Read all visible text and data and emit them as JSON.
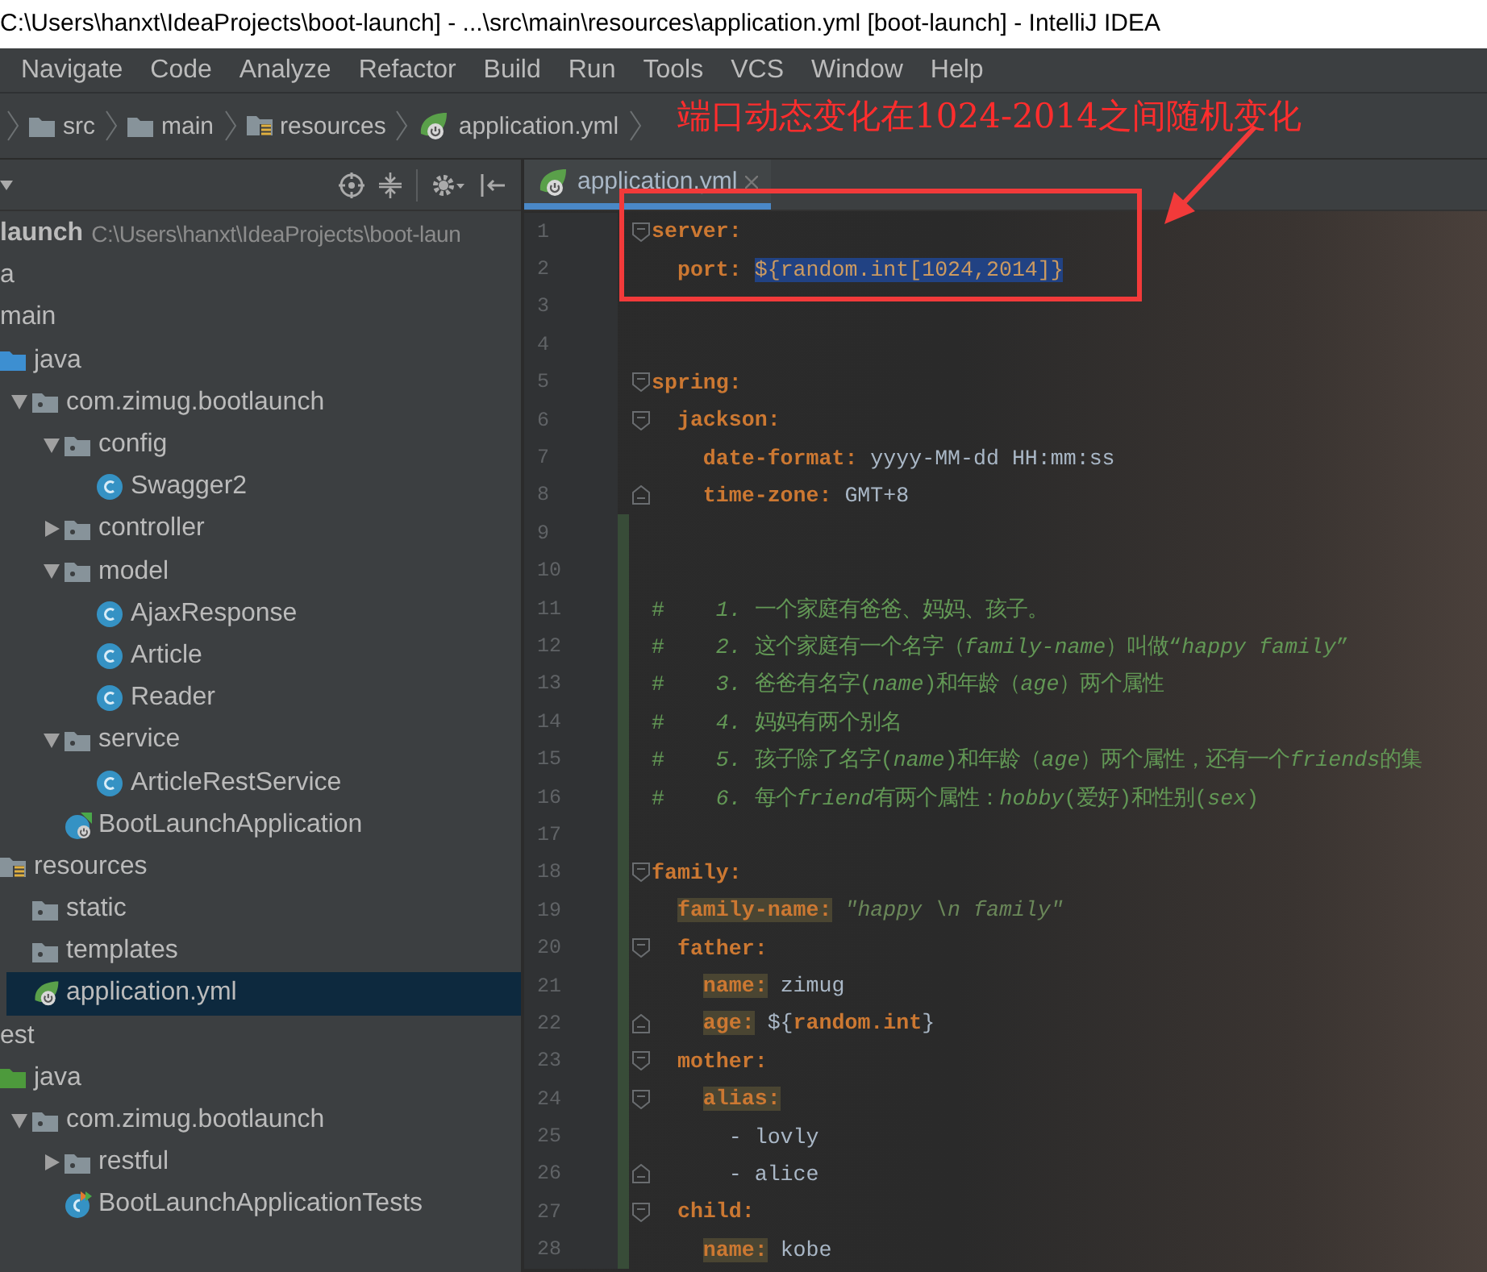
{
  "window": {
    "title": "C:\\Users\\hanxt\\IdeaProjects\\boot-launch] - ...\\src\\main\\resources\\application.yml [boot-launch] - IntelliJ IDEA"
  },
  "menu": [
    "Navigate",
    "Code",
    "Analyze",
    "Refactor",
    "Build",
    "Run",
    "Tools",
    "VCS",
    "Window",
    "Help"
  ],
  "breadcrumbs": [
    {
      "label": "src",
      "kind": "folder"
    },
    {
      "label": "main",
      "kind": "folder"
    },
    {
      "label": "resources",
      "kind": "resources"
    },
    {
      "label": "application.yml",
      "kind": "config"
    }
  ],
  "annotation": {
    "text": "端口动态变化在1024-2014之间随机变化"
  },
  "project_tree": [
    {
      "name": "launch",
      "path": "C:\\Users\\hanxt\\IdeaProjects\\boot-laun",
      "selected": false,
      "children": [
        {
          "name": "a",
          "selected": false
        },
        {
          "name": "main",
          "selected": false,
          "children": [
            {
              "name": "java",
              "kind": "source",
              "selected": false,
              "children": [
                {
                  "name": "com.zimug.bootlaunch",
                  "kind": "package",
                  "expanded": true,
                  "selected": false,
                  "children": [
                    {
                      "name": "config",
                      "kind": "package",
                      "expanded": true,
                      "selected": false,
                      "children": [
                        {
                          "name": "Swagger2",
                          "kind": "class",
                          "selected": false
                        }
                      ]
                    },
                    {
                      "name": "controller",
                      "kind": "package",
                      "expanded": false,
                      "selected": false
                    },
                    {
                      "name": "model",
                      "kind": "package",
                      "expanded": true,
                      "selected": false,
                      "children": [
                        {
                          "name": "AjaxResponse",
                          "kind": "class",
                          "selected": false
                        },
                        {
                          "name": "Article",
                          "kind": "class",
                          "selected": false
                        },
                        {
                          "name": "Reader",
                          "kind": "class",
                          "selected": false
                        }
                      ]
                    },
                    {
                      "name": "service",
                      "kind": "package",
                      "expanded": true,
                      "selected": false,
                      "children": [
                        {
                          "name": "ArticleRestService",
                          "kind": "class",
                          "selected": false
                        }
                      ]
                    },
                    {
                      "name": "BootLaunchApplication",
                      "kind": "application",
                      "selected": false
                    }
                  ]
                }
              ]
            },
            {
              "name": "resources",
              "kind": "resources",
              "selected": false,
              "children": [
                {
                  "name": "static",
                  "kind": "package",
                  "selected": false
                },
                {
                  "name": "templates",
                  "kind": "package",
                  "selected": false
                },
                {
                  "name": "application.yml",
                  "kind": "config",
                  "selected": true
                }
              ]
            }
          ]
        },
        {
          "name": "est",
          "selected": false,
          "children": [
            {
              "name": "java",
              "kind": "tests",
              "selected": false,
              "children": [
                {
                  "name": "com.zimug.bootlaunch",
                  "kind": "package",
                  "expanded": true,
                  "selected": false,
                  "children": [
                    {
                      "name": "restful",
                      "kind": "package",
                      "expanded": false,
                      "selected": false
                    },
                    {
                      "name": "BootLaunchApplicationTests",
                      "kind": "test",
                      "selected": false
                    }
                  ]
                }
              ]
            }
          ]
        }
      ]
    }
  ],
  "editor": {
    "tabs": [
      {
        "label": "application.yml",
        "selected": true
      }
    ],
    "lines": [
      {
        "number": "1",
        "kind": "opener",
        "changed": false,
        "segments": [
          {
            "kind": "key",
            "text": "server:"
          }
        ]
      },
      {
        "number": "2",
        "kind": "plain",
        "changed": false,
        "segments": [
          {
            "kind": "key",
            "text": "  port:"
          },
          {
            "kind": "selected",
            "text": " ${random.int[1024,2014]}"
          }
        ]
      },
      {
        "number": "3",
        "kind": "plain",
        "changed": false
      },
      {
        "number": "4",
        "kind": "plain",
        "changed": false
      },
      {
        "number": "5",
        "kind": "opener",
        "changed": false,
        "segments": [
          {
            "kind": "key",
            "text": "spring:"
          }
        ]
      },
      {
        "number": "6",
        "kind": "opener",
        "changed": false,
        "segments": [
          {
            "kind": "key",
            "text": "  jackson:"
          }
        ]
      },
      {
        "number": "7",
        "kind": "plain",
        "changed": false,
        "segments": [
          {
            "kind": "key",
            "text": "    date-format:"
          },
          {
            "kind": "value",
            "text": " yyyy-MM-dd HH:mm:ss"
          }
        ]
      },
      {
        "number": "8",
        "kind": "closer",
        "changed": false,
        "segments": [
          {
            "kind": "key",
            "text": "    time-zone:"
          },
          {
            "kind": "value",
            "text": " GMT+8"
          }
        ]
      },
      {
        "number": "9",
        "kind": "plain",
        "changed": true
      },
      {
        "number": "10",
        "kind": "plain",
        "changed": true
      },
      {
        "number": "11",
        "kind": "plain",
        "changed": true,
        "segments": [
          {
            "kind": "comment",
            "text": "#    "
          },
          {
            "kind": "comment-em",
            "text": "1."
          },
          {
            "kind": "comment",
            "text": " 一个家庭有爸爸、妈妈、孩子。"
          }
        ]
      },
      {
        "number": "12",
        "kind": "plain",
        "changed": true,
        "segments": [
          {
            "kind": "comment",
            "text": "#    "
          },
          {
            "kind": "comment-em",
            "text": "2."
          },
          {
            "kind": "comment",
            "text": " 这个家庭有一个名字（"
          },
          {
            "kind": "comment-em",
            "text": "family-name"
          },
          {
            "kind": "comment",
            "text": "）叫做“"
          },
          {
            "kind": "comment-em",
            "text": "happy family"
          },
          {
            "kind": "comment",
            "text": "”"
          }
        ]
      },
      {
        "number": "13",
        "kind": "plain",
        "changed": true,
        "segments": [
          {
            "kind": "comment",
            "text": "#    "
          },
          {
            "kind": "comment-em",
            "text": "3."
          },
          {
            "kind": "comment",
            "text": " 爸爸有名字("
          },
          {
            "kind": "comment-em",
            "text": "name"
          },
          {
            "kind": "comment",
            "text": ")和年龄（"
          },
          {
            "kind": "comment-em",
            "text": "age"
          },
          {
            "kind": "comment",
            "text": "）两个属性"
          }
        ]
      },
      {
        "number": "14",
        "kind": "plain",
        "changed": true,
        "segments": [
          {
            "kind": "comment",
            "text": "#    "
          },
          {
            "kind": "comment-em",
            "text": "4."
          },
          {
            "kind": "comment",
            "text": " 妈妈有两个别名"
          }
        ]
      },
      {
        "number": "15",
        "kind": "plain",
        "changed": true,
        "segments": [
          {
            "kind": "comment",
            "text": "#    "
          },
          {
            "kind": "comment-em",
            "text": "5."
          },
          {
            "kind": "comment",
            "text": " 孩子除了名字("
          },
          {
            "kind": "comment-em",
            "text": "name"
          },
          {
            "kind": "comment",
            "text": ")和年龄（"
          },
          {
            "kind": "comment-em",
            "text": "age"
          },
          {
            "kind": "comment",
            "text": "）两个属性，还有一个"
          },
          {
            "kind": "comment-em",
            "text": "friends"
          },
          {
            "kind": "comment",
            "text": "的集"
          }
        ]
      },
      {
        "number": "16",
        "kind": "plain",
        "changed": true,
        "segments": [
          {
            "kind": "comment",
            "text": "#    "
          },
          {
            "kind": "comment-em",
            "text": "6."
          },
          {
            "kind": "comment",
            "text": " 每个"
          },
          {
            "kind": "comment-em",
            "text": "friend"
          },
          {
            "kind": "comment",
            "text": "有两个属性："
          },
          {
            "kind": "comment-em",
            "text": "hobby"
          },
          {
            "kind": "comment",
            "text": "(爱好)和性别("
          },
          {
            "kind": "comment-em",
            "text": "sex"
          },
          {
            "kind": "comment",
            "text": ")"
          }
        ]
      },
      {
        "number": "17",
        "kind": "plain",
        "changed": true
      },
      {
        "number": "18",
        "kind": "opener",
        "changed": true,
        "segments": [
          {
            "kind": "key",
            "text": "family:"
          }
        ]
      },
      {
        "number": "19",
        "kind": "plain",
        "changed": true,
        "segments": [
          {
            "kind": "key-marked",
            "text": "  family-name:"
          },
          {
            "kind": "string",
            "text": " \"happy \\n family\""
          }
        ]
      },
      {
        "number": "20",
        "kind": "opener",
        "changed": true,
        "segments": [
          {
            "kind": "key",
            "text": "  father:"
          }
        ]
      },
      {
        "number": "21",
        "kind": "plain",
        "changed": true,
        "segments": [
          {
            "kind": "key-marked",
            "text": "    name:"
          },
          {
            "kind": "value",
            "text": " zimug"
          }
        ]
      },
      {
        "number": "22",
        "kind": "closer",
        "changed": true,
        "segments": [
          {
            "kind": "key-marked",
            "text": "    age:"
          },
          {
            "kind": "value",
            "text": " ${"
          },
          {
            "kind": "reference",
            "text": "random.int"
          },
          {
            "kind": "value",
            "text": "}"
          }
        ]
      },
      {
        "number": "23",
        "kind": "opener",
        "changed": true,
        "segments": [
          {
            "kind": "key",
            "text": "  mother:"
          }
        ]
      },
      {
        "number": "24",
        "kind": "opener",
        "changed": true,
        "segments": [
          {
            "kind": "key-marked",
            "text": "    alias:"
          }
        ]
      },
      {
        "number": "25",
        "kind": "plain",
        "changed": true,
        "segments": [
          {
            "kind": "value",
            "text": "      - lovly"
          }
        ]
      },
      {
        "number": "26",
        "kind": "closer",
        "changed": true,
        "segments": [
          {
            "kind": "value",
            "text": "      - alice"
          }
        ]
      },
      {
        "number": "27",
        "kind": "opener",
        "changed": true,
        "segments": [
          {
            "kind": "key",
            "text": "  child:"
          }
        ]
      },
      {
        "number": "28",
        "kind": "plain",
        "changed": true,
        "segments": [
          {
            "kind": "key-marked",
            "text": "    name:"
          },
          {
            "kind": "value",
            "text": " kobe"
          }
        ]
      }
    ]
  }
}
